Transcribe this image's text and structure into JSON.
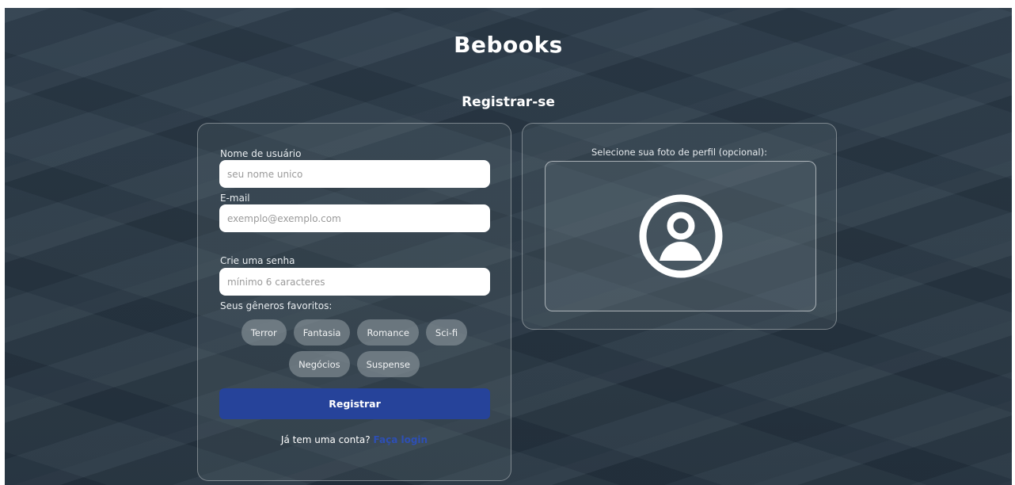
{
  "app": {
    "brand": "Bebooks"
  },
  "page": {
    "heading": "Registrar-se"
  },
  "form": {
    "username": {
      "label": "Nome de usuário",
      "placeholder": "seu nome unico"
    },
    "email": {
      "label": "E-mail",
      "placeholder": "exemplo@exemplo.com"
    },
    "password": {
      "label": "Crie uma senha",
      "placeholder": "mínimo 6 caracteres"
    },
    "genres": {
      "label": "Seus gêneros favoritos:",
      "items": [
        "Terror",
        "Fantasia",
        "Romance",
        "Sci-fi",
        "Negócios",
        "Suspense"
      ]
    },
    "submit_label": "Registrar",
    "login_prompt": "Já tem uma conta?",
    "login_link": "Faça login"
  },
  "photo": {
    "label": "Selecione sua foto de perfil (opcional):",
    "icon": "user-circle-icon"
  },
  "colors": {
    "background": "#2a3946",
    "primary_button": "#26439a",
    "link": "#2d4fb5",
    "chip": "#8c979c"
  }
}
